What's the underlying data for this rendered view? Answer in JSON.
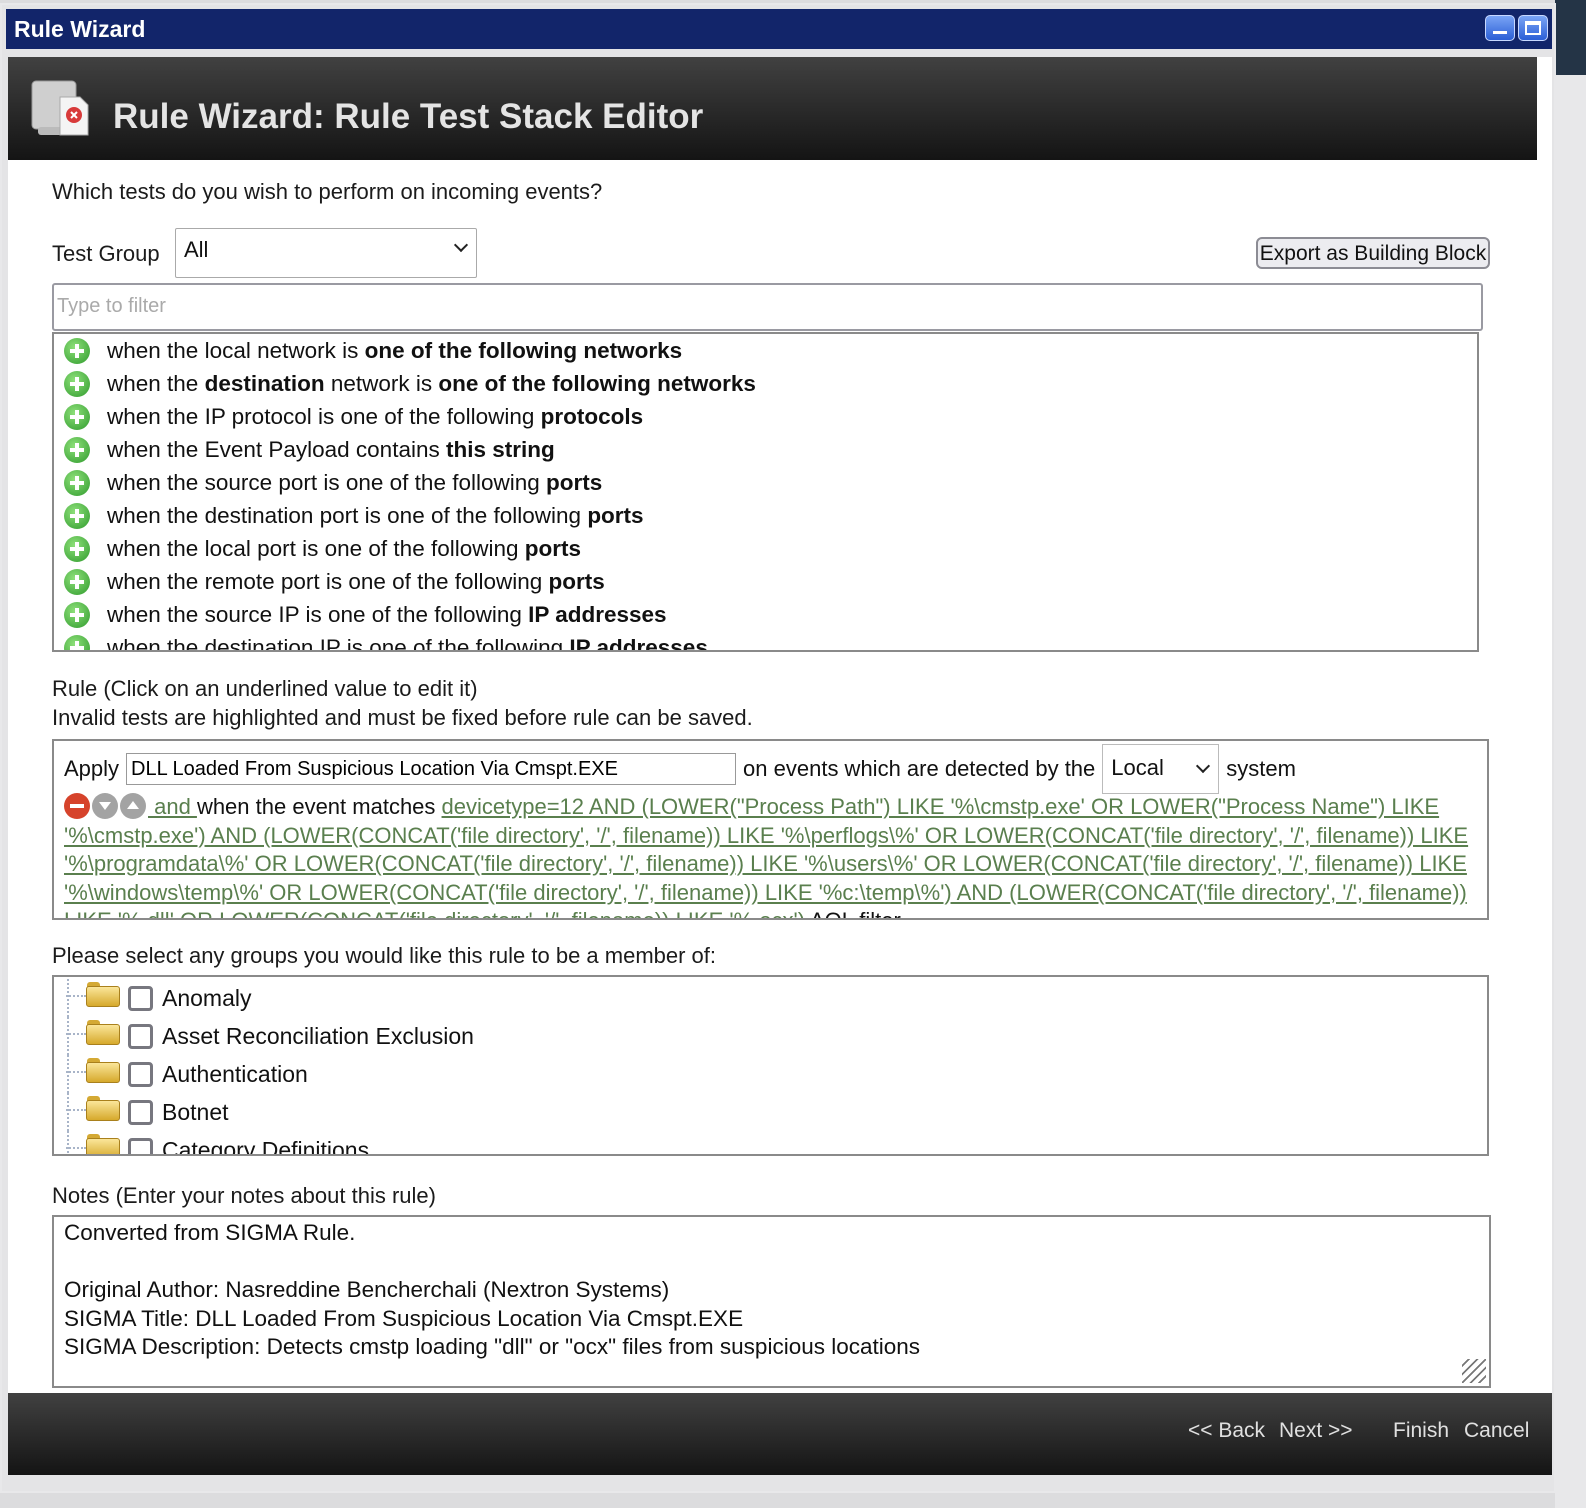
{
  "window": {
    "title": "Rule Wizard"
  },
  "header": {
    "title": "Rule Wizard: Rule Test Stack Editor"
  },
  "question": "Which tests do you wish to perform on incoming events?",
  "test_group": {
    "label": "Test Group",
    "value": "All"
  },
  "export_button": "Export as Building Block",
  "filter": {
    "placeholder": "Type to filter"
  },
  "tests": [
    [
      {
        "t": "when the local network is "
      },
      {
        "t": "one of the following networks",
        "b": true
      }
    ],
    [
      {
        "t": "when the "
      },
      {
        "t": "destination",
        "b": true
      },
      {
        "t": " network is "
      },
      {
        "t": "one of the following networks",
        "b": true
      }
    ],
    [
      {
        "t": "when the IP protocol is one of the following "
      },
      {
        "t": "protocols",
        "b": true
      }
    ],
    [
      {
        "t": "when the Event Payload contains "
      },
      {
        "t": "this string",
        "b": true
      }
    ],
    [
      {
        "t": "when the source port is one of the following "
      },
      {
        "t": "ports",
        "b": true
      }
    ],
    [
      {
        "t": "when the destination port is one of the following "
      },
      {
        "t": "ports",
        "b": true
      }
    ],
    [
      {
        "t": "when the local port is one of the following "
      },
      {
        "t": "ports",
        "b": true
      }
    ],
    [
      {
        "t": "when the remote port is one of the following "
      },
      {
        "t": "ports",
        "b": true
      }
    ],
    [
      {
        "t": "when the source IP is one of the following "
      },
      {
        "t": "IP addresses",
        "b": true
      }
    ],
    [
      {
        "t": "when the destination IP is one of the following "
      },
      {
        "t": "IP addresses",
        "b": true
      }
    ]
  ],
  "rule": {
    "heading1": "Rule (Click on an underlined value to edit it)",
    "heading2": "Invalid tests are highlighted and must be fixed before rule can be saved.",
    "apply": "Apply",
    "rule_name": "DLL Loaded From Suspicious Location Via Cmspt.EXE",
    "detected_by": "on events which are detected by the",
    "system_value": "Local",
    "system": "system",
    "and": " and ",
    "matches": "when the event matches ",
    "expression": "devicetype=12 AND (LOWER(\"Process Path\") LIKE '%\\cmstp.exe' OR LOWER(\"Process Name\") LIKE '%\\cmstp.exe') AND (LOWER(CONCAT('file directory', '/', filename)) LIKE '%\\perflogs\\%' OR LOWER(CONCAT('file directory', '/', filename)) LIKE '%\\programdata\\%' OR LOWER(CONCAT('file directory', '/', filename)) LIKE '%\\users\\%' OR LOWER(CONCAT('file directory', '/', filename)) LIKE '%\\windows\\temp\\%' OR LOWER(CONCAT('file directory', '/', filename)) LIKE '%c:\\temp\\%') AND (LOWER(CONCAT('file directory', '/', filename)) LIKE '%.dll' OR LOWER(CONCAT('file directory', '/', filename)) LIKE '%.ocx')",
    "suffix": " AQL filter"
  },
  "groups": {
    "heading": "Please select any groups you would like this rule to be a member of:",
    "items": [
      "Anomaly",
      "Asset Reconciliation Exclusion",
      "Authentication",
      "Botnet",
      "Category Definitions"
    ]
  },
  "notes": {
    "heading": "Notes (Enter your notes about this rule)",
    "value": "Converted from SIGMA Rule.\n\nOriginal Author: Nasreddine Bencherchali (Nextron Systems)\nSIGMA Title: DLL Loaded From Suspicious Location Via Cmspt.EXE\nSIGMA Description: Detects cmstp loading \"dll\" or \"ocx\" files from suspicious locations"
  },
  "footer": {
    "back": "<< Back",
    "next": "Next >>",
    "finish": "Finish",
    "cancel": "Cancel"
  }
}
